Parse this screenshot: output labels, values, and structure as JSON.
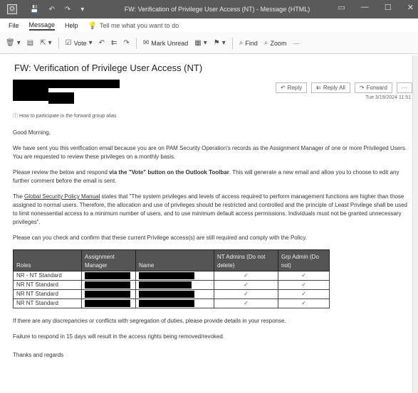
{
  "window": {
    "title": "FW: Verification of Privilege User Access (NT) - Message (HTML)",
    "controls": [
      "▭",
      "—",
      "☐",
      "✕"
    ]
  },
  "menu": {
    "file": "File",
    "message": "Message",
    "help": "Help",
    "tellme": "Tell me what you want to do"
  },
  "ribbon": {
    "delete": "Delete",
    "archive": "Archive",
    "vote": "Vote",
    "reply": "Reply",
    "replyall": "Reply All",
    "forward": "Forward",
    "markunread": "Mark Unread",
    "categorize": "Categorize",
    "followup": "Follow Up",
    "find": "Find",
    "zoom": "Zoom",
    "more": "···"
  },
  "email": {
    "subject": "FW: Verification of Privilege User Access (NT)",
    "actions": {
      "reply": "Reply",
      "replyall": "Reply All",
      "forward": "Forward",
      "more": "···"
    },
    "date": "Tue 3/19/2024 11:51",
    "note": "How to participate in the forward group alias",
    "greeting": "Good Morning,",
    "para1": "We have sent you this verification email because you are on PAM Security Operation's records as the Assignment Manager of one or more Privileged Users. You are requested to review these privileges on a monthly basis.",
    "para2_pre": "Please review the below and respond ",
    "para2_bold": "via the \"Vote\" button on the Outlook Toolbar",
    "para2_post": ". This will generate a new email and allow you to choose to edit any further comment before the email is sent.",
    "para3_link": "Global Security Policy Manual",
    "para3_pre": "The ",
    "para3_post": " states that \"The system privileges and levels of access required to perform management functions are higher than those assigned to normal users. Therefore, the allocation and use of privileges should be restricted and controlled and the principle of Least Privilege shall be used to limit nonessential access to a minimum number of users, and to use minimum default access permissions. Individuals must not be granted unnecessary privileges\".",
    "para4": "Please can you check and confirm that these current Privilege access(s) are still required and comply with the Policy.",
    "para5": "If there are any discrepancies or conflicts with segregation of duties, please provide details in your response.",
    "para6": "Failure to respond in 15 days will result in the access rights being removed/revoked.",
    "closing": "Thanks and regards"
  },
  "table": {
    "headers": [
      "Roles",
      "Assignment Manager",
      "Name",
      "NT Admins (Do not delete)",
      "Grp Admin (Do not)"
    ],
    "rows": [
      {
        "role": "NR - NT Standard",
        "c1": "✓",
        "c2": "✓"
      },
      {
        "role": "NR NT Standard",
        "c1": "✓",
        "c2": "✓"
      },
      {
        "role": "NR NT Standard",
        "c1": "✓",
        "c2": "✓"
      },
      {
        "role": "NR NT Standard",
        "c1": "✓",
        "c2": "✓"
      }
    ]
  }
}
